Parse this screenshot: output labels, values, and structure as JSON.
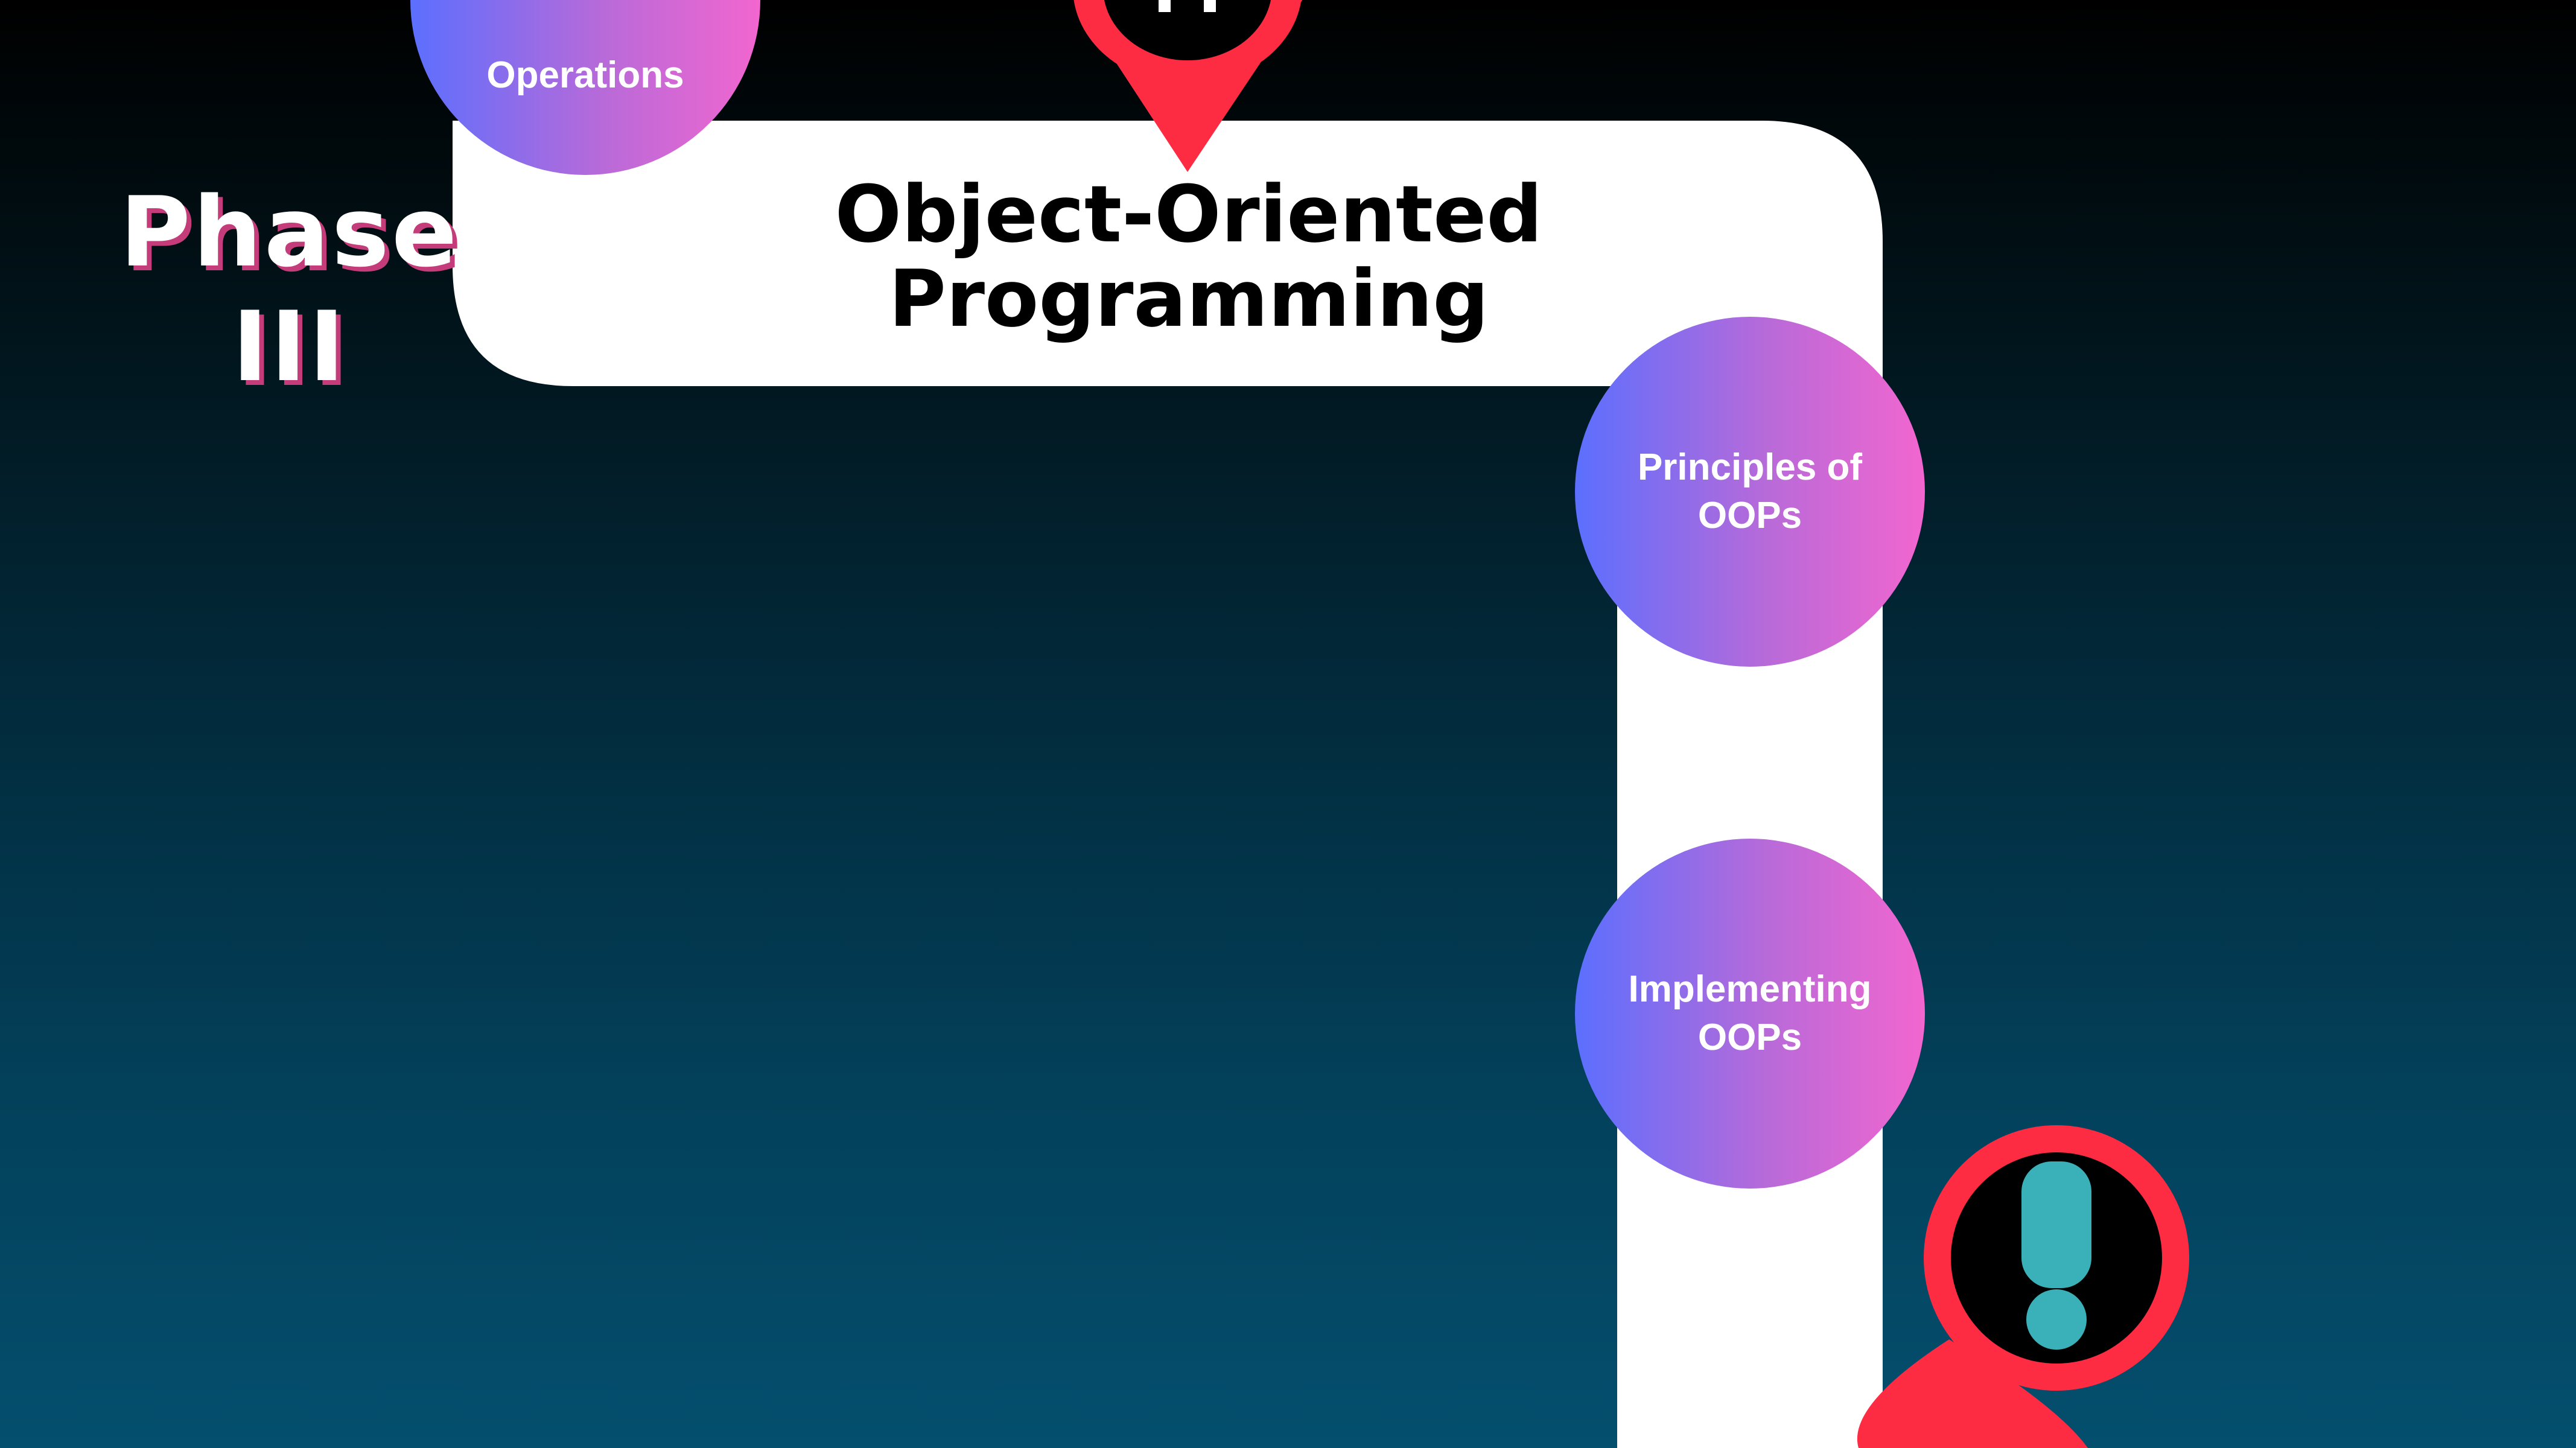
{
  "phase": {
    "line1": "Phase",
    "line2": "III"
  },
  "title": {
    "line1": "Object-Oriented",
    "line2": "Programming"
  },
  "nodes": {
    "operations": "Operations",
    "principles": "Principles of OOPs",
    "implementing": "Implementing OOPs"
  },
  "colors": {
    "path": "#ffffff",
    "node_gradient_start": "#5b6ffe",
    "node_gradient_end": "#f266cf",
    "pin": "#fd2c43",
    "pin_inner": "#000000",
    "alert_mark": "#3ab0b8",
    "phase_shadow": "#c43c7a"
  },
  "icons": {
    "top_pin": "map-pin-icon",
    "bottom_pin": "map-pin-alert-icon"
  }
}
